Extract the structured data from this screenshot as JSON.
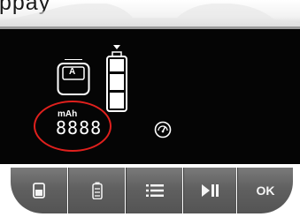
{
  "header": {
    "partial_text": "ppay"
  },
  "display": {
    "slot_letter": "A",
    "capacity_unit": "mAh",
    "capacity_digits": "8888",
    "battery_level_segments": 3,
    "highlight_color": "#e0201d",
    "lcd_color": "#050505",
    "segment_color": "#ffffff"
  },
  "buttons": [
    {
      "icon": "battery-single-icon",
      "label": ""
    },
    {
      "icon": "battery-stack-icon",
      "label": ""
    },
    {
      "icon": "menu-list-icon",
      "label": ""
    },
    {
      "icon": "play-pause-icon",
      "label": ""
    },
    {
      "icon": "",
      "label": "OK"
    }
  ]
}
